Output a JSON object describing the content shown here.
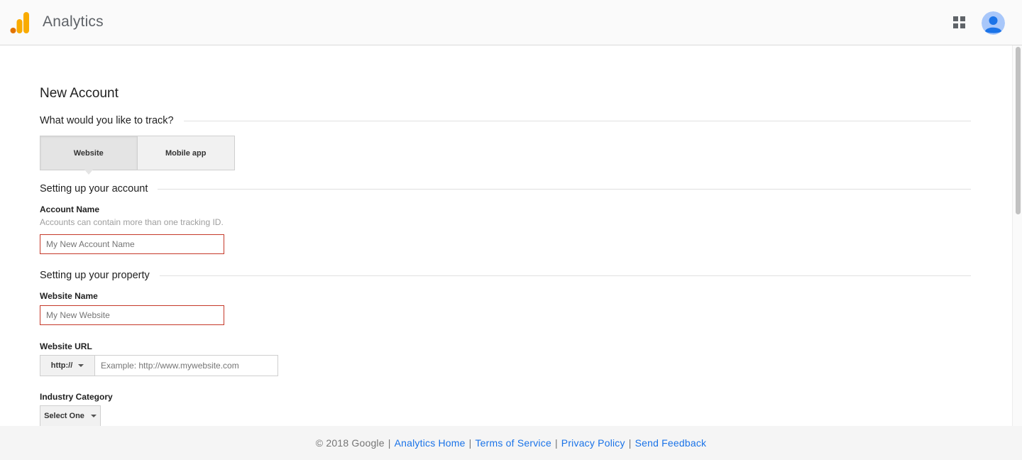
{
  "header": {
    "title": "Analytics",
    "logo_colors": [
      "#e37400",
      "#f9ab00",
      "#f9ab00"
    ],
    "apps_icon": "apps-grid-icon",
    "avatar_icon": "account-avatar-icon",
    "avatar_color": "#4285f4"
  },
  "page": {
    "title": "New Account"
  },
  "track": {
    "heading": "What would you like to track?",
    "tabs": [
      {
        "label": "Website",
        "selected": true
      },
      {
        "label": "Mobile app",
        "selected": false
      }
    ]
  },
  "account": {
    "heading": "Setting up your account",
    "name_label": "Account Name",
    "name_hint": "Accounts can contain more than one tracking ID.",
    "name_placeholder": "My New Account Name"
  },
  "property": {
    "heading": "Setting up your property",
    "website_name_label": "Website Name",
    "website_name_placeholder": "My New Website",
    "url_label": "Website URL",
    "protocol_value": "http://",
    "url_placeholder": "Example: http://www.mywebsite.com",
    "industry_label": "Industry Category",
    "industry_value": "Select One"
  },
  "footer": {
    "copyright": "© 2018 Google",
    "links": [
      "Analytics Home",
      "Terms of Service",
      "Privacy Policy",
      "Send Feedback"
    ],
    "link_color": "#1a73e8"
  },
  "colors": {
    "error_border": "#c53929",
    "header_bg": "#fafafa"
  }
}
